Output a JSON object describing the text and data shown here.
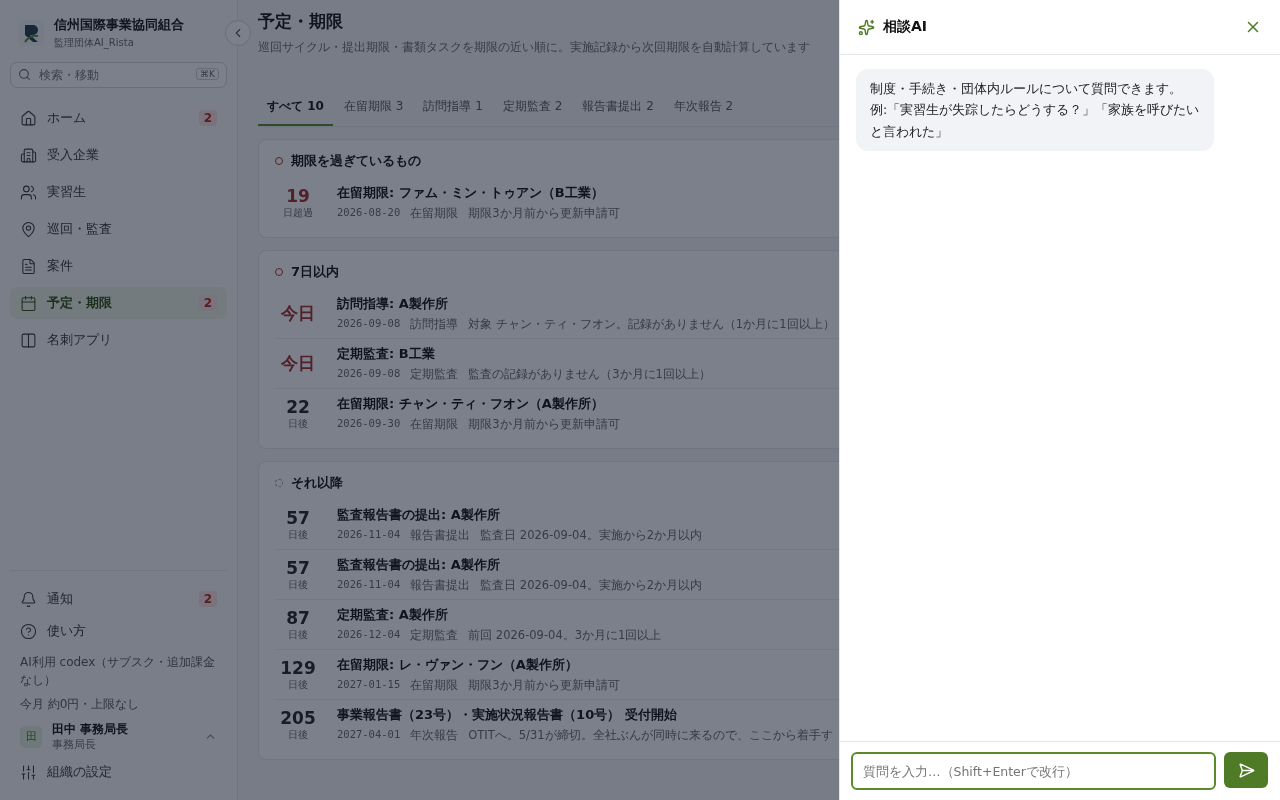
{
  "sidebar": {
    "org_name": "信州国際事業協同組合",
    "org_sub": "監理団体AI_Rista",
    "search": {
      "placeholder": "検索・移動",
      "shortcut": "⌘K"
    },
    "nav": [
      {
        "label": "ホーム",
        "badge": "2",
        "selected": false
      },
      {
        "label": "受入企業",
        "selected": false
      },
      {
        "label": "実習生",
        "selected": false
      },
      {
        "label": "巡回・監査",
        "selected": false
      },
      {
        "label": "案件",
        "selected": false
      },
      {
        "label": "予定・期限",
        "badge": "2",
        "selected": true
      },
      {
        "label": "名刺アプリ",
        "selected": false
      }
    ],
    "bottom_nav": [
      {
        "label": "通知",
        "badge": "2"
      },
      {
        "label": "使い方"
      }
    ],
    "usage": [
      "AI利用 codex（サブスク・追加課金なし）",
      "今月 約0円・上限なし"
    ],
    "user": {
      "initial": "田",
      "name": "田中 事務局長",
      "role": "事務局長"
    },
    "settings": "組織の設定"
  },
  "main": {
    "title": "予定・期限",
    "subtitle": "巡回サイクル・提出期限・書類タスクを期限の近い順に。実施記録から次回期限を自動計算しています",
    "tabs": [
      {
        "label": "すべて",
        "count": "10",
        "selected": true
      },
      {
        "label": "在留期限",
        "count": "3",
        "selected": false
      },
      {
        "label": "訪問指導",
        "count": "1",
        "selected": false
      },
      {
        "label": "定期監査",
        "count": "2",
        "selected": false
      },
      {
        "label": "報告書提出",
        "count": "2",
        "selected": false
      },
      {
        "label": "年次報告",
        "count": "2",
        "selected": false
      }
    ],
    "sections": [
      {
        "title": "期限を過ぎているもの",
        "kind": "urgent",
        "items": [
          {
            "days": "19",
            "unit": "日超過",
            "urgent": true,
            "title": "在留期限: ファム・ミン・トゥアン（B工業）",
            "date": "2026-08-20",
            "category": "在留期限",
            "note": "期限3か月前から更新申請可"
          }
        ]
      },
      {
        "title": "7日以内",
        "kind": "urgent",
        "items": [
          {
            "days": "今日",
            "urgent": true,
            "title": "訪問指導: A製作所",
            "date": "2026-09-08",
            "category": "訪問指導",
            "note": "対象 チャン・ティ・フオン。記録がありません（1か月に1回以上）"
          },
          {
            "days": "今日",
            "urgent": true,
            "title": "定期監査: B工業",
            "date": "2026-09-08",
            "category": "定期監査",
            "note": "監査の記録がありません（3か月に1回以上）"
          },
          {
            "days": "22",
            "unit": "日後",
            "urgent": false,
            "title": "在留期限: チャン・ティ・フオン（A製作所）",
            "date": "2026-09-30",
            "category": "在留期限",
            "note": "期限3か月前から更新申請可"
          }
        ]
      },
      {
        "title": "それ以降",
        "kind": "later",
        "items": [
          {
            "days": "57",
            "unit": "日後",
            "urgent": false,
            "title": "監査報告書の提出: A製作所",
            "date": "2026-11-04",
            "category": "報告書提出",
            "note": "監査日 2026-09-04。実施から2か月以内"
          },
          {
            "days": "57",
            "unit": "日後",
            "urgent": false,
            "title": "監査報告書の提出: A製作所",
            "date": "2026-11-04",
            "category": "報告書提出",
            "note": "監査日 2026-09-04。実施から2か月以内"
          },
          {
            "days": "87",
            "unit": "日後",
            "urgent": false,
            "title": "定期監査: A製作所",
            "date": "2026-12-04",
            "category": "定期監査",
            "note": "前回 2026-09-04。3か月に1回以上"
          },
          {
            "days": "129",
            "unit": "日後",
            "urgent": false,
            "title": "在留期限: レ・ヴァン・フン（A製作所）",
            "date": "2027-01-15",
            "category": "在留期限",
            "note": "期限3か月前から更新申請可"
          },
          {
            "days": "205",
            "unit": "日後",
            "urgent": false,
            "title": "事業報告書（23号）・実施状況報告書（10号） 受付開始",
            "date": "2027-04-01",
            "category": "年次報告",
            "note": "OTITへ。5/31が締切。全社ぶんが同時に来るので、ここから着手す"
          }
        ]
      }
    ]
  },
  "chat": {
    "title": "相談AI",
    "messages": [
      {
        "lines": [
          "制度・手続き・団体内ルールについて質問できます。",
          "例:「実習生が失踪したらどうする？」「家族を呼びたいと言われた」"
        ]
      }
    ],
    "input": {
      "placeholder": "質問を入力…（Shift+Enterで改行）"
    }
  }
}
